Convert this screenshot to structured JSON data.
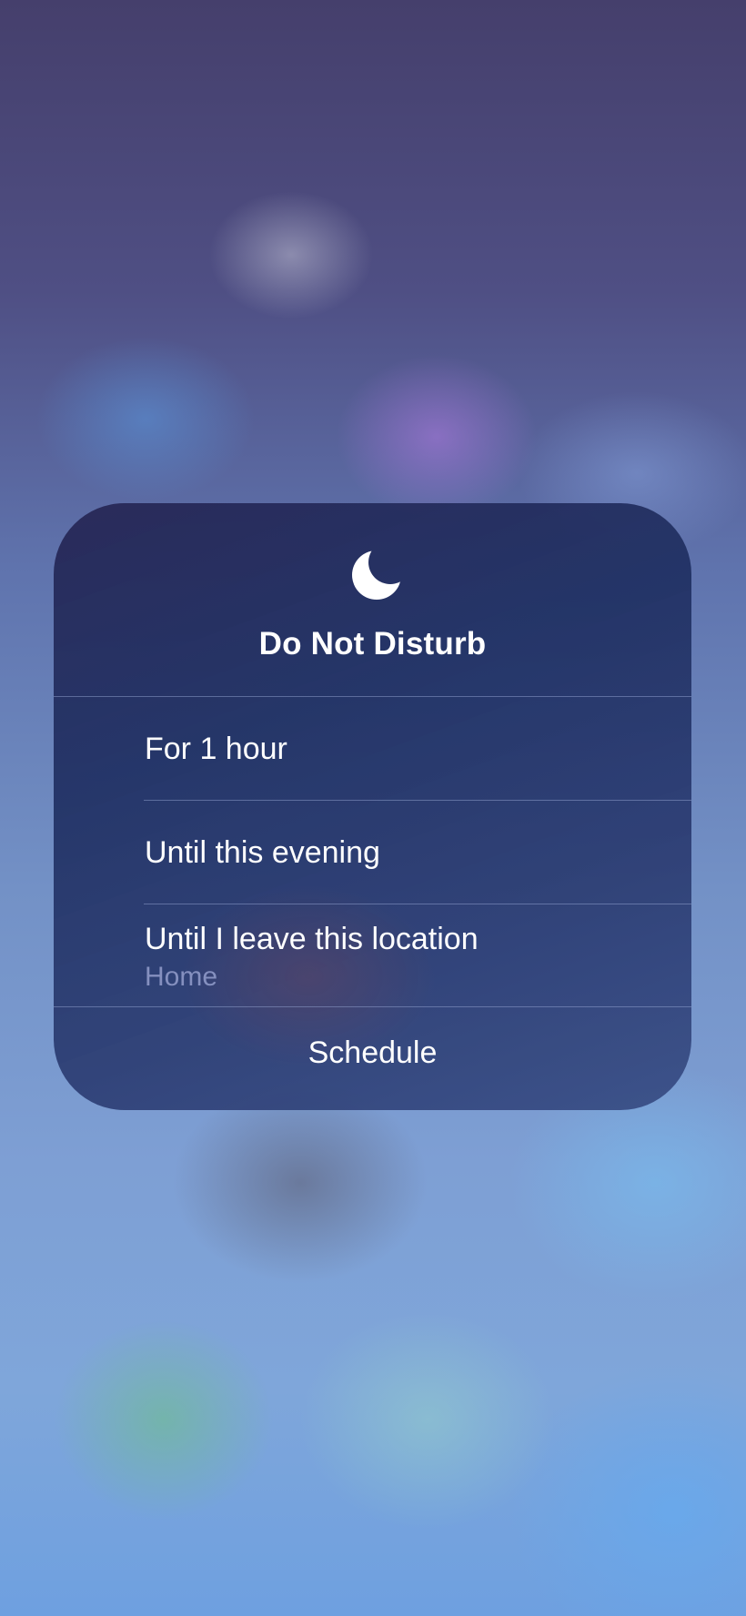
{
  "panel": {
    "title": "Do Not Disturb",
    "icon": "moon-icon",
    "options": [
      {
        "label": "For 1 hour"
      },
      {
        "label": "Until this evening"
      },
      {
        "label": "Until I leave this location",
        "sublabel": "Home"
      }
    ],
    "schedule_label": "Schedule"
  },
  "colors": {
    "sublabel": "#8590bf",
    "text": "#ffffff"
  }
}
